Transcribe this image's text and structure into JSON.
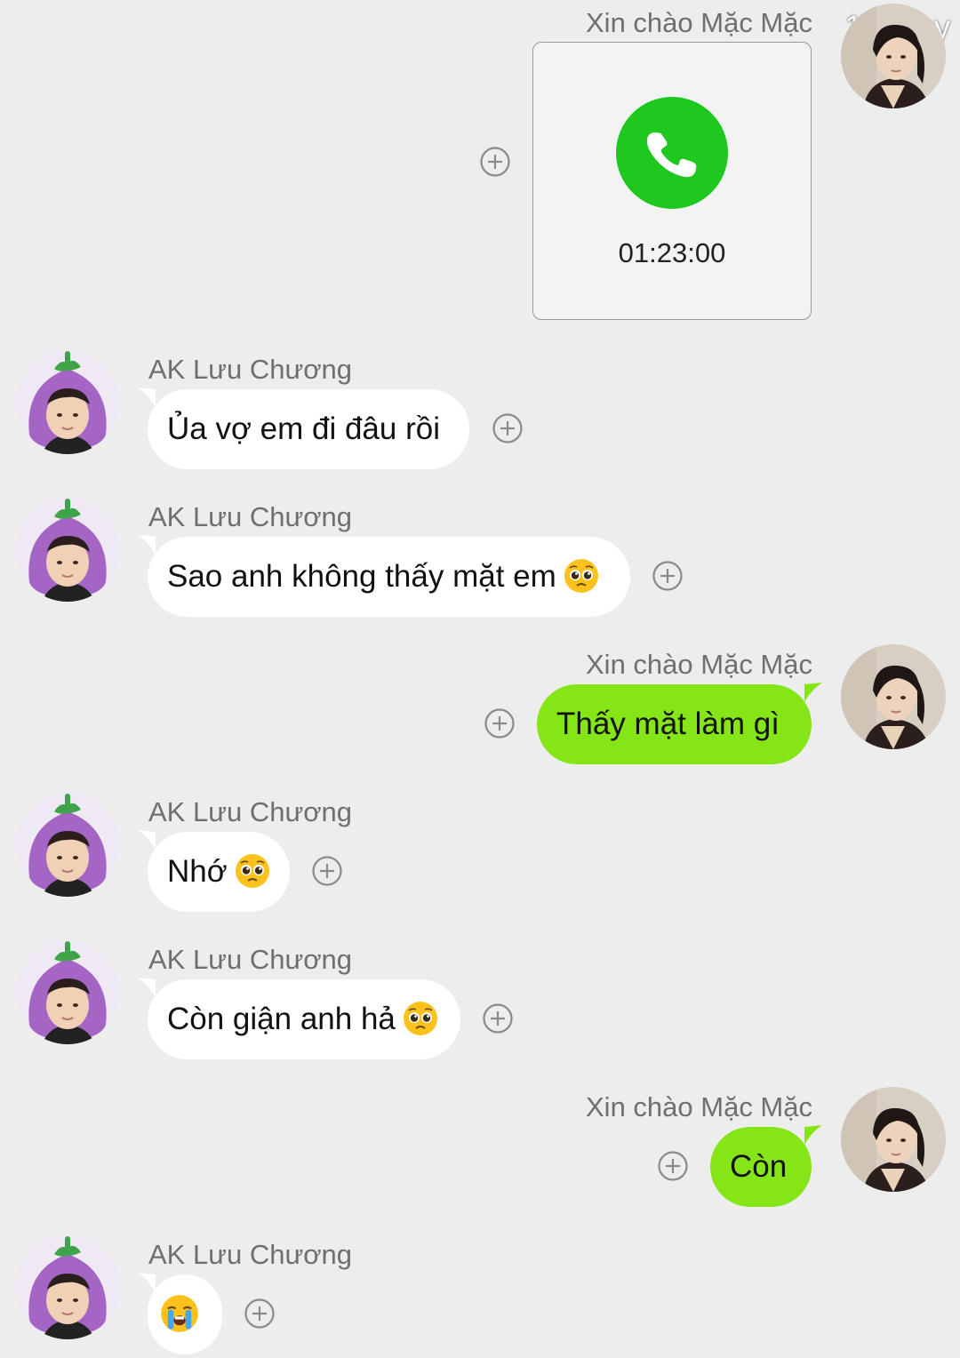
{
  "watermark": "148 joy",
  "colors": {
    "background": "#ededed",
    "incoming_bubble": "#ffffff",
    "outgoing_bubble": "#86e516",
    "call_icon": "#1fc81f",
    "name_text": "#6f6f6f"
  },
  "participants": {
    "me": {
      "name": "Xin chào Mặc Mặc",
      "avatar_icon": "avatar-photo-man"
    },
    "other": {
      "name": "AK Lưu Chương",
      "avatar_icon": "avatar-photo-eggplant-hat"
    }
  },
  "messages": [
    {
      "sender": "Xin chào Mặc Mặc",
      "type": "call",
      "duration": "01:23:00",
      "icon": "phone-icon"
    },
    {
      "sender": "AK Lưu Chương",
      "type": "text",
      "text": "Ủa vợ em đi đâu rồi"
    },
    {
      "sender": "AK Lưu Chương",
      "type": "text",
      "text": "Sao anh không thấy mặt em",
      "emoji": "pleading-face-emoji"
    },
    {
      "sender": "Xin chào Mặc Mặc",
      "type": "text",
      "text": "Thấy mặt làm gì"
    },
    {
      "sender": "AK Lưu Chương",
      "type": "text",
      "text": "Nhớ",
      "emoji": "pleading-face-emoji"
    },
    {
      "sender": "AK Lưu Chương",
      "type": "text",
      "text": "Còn giận anh hả",
      "emoji": "pleading-face-emoji"
    },
    {
      "sender": "Xin chào Mặc Mặc",
      "type": "text",
      "text": "Còn"
    },
    {
      "sender": "AK Lưu Chương",
      "type": "emoji",
      "emoji": "loudly-crying-face-emoji"
    }
  ]
}
